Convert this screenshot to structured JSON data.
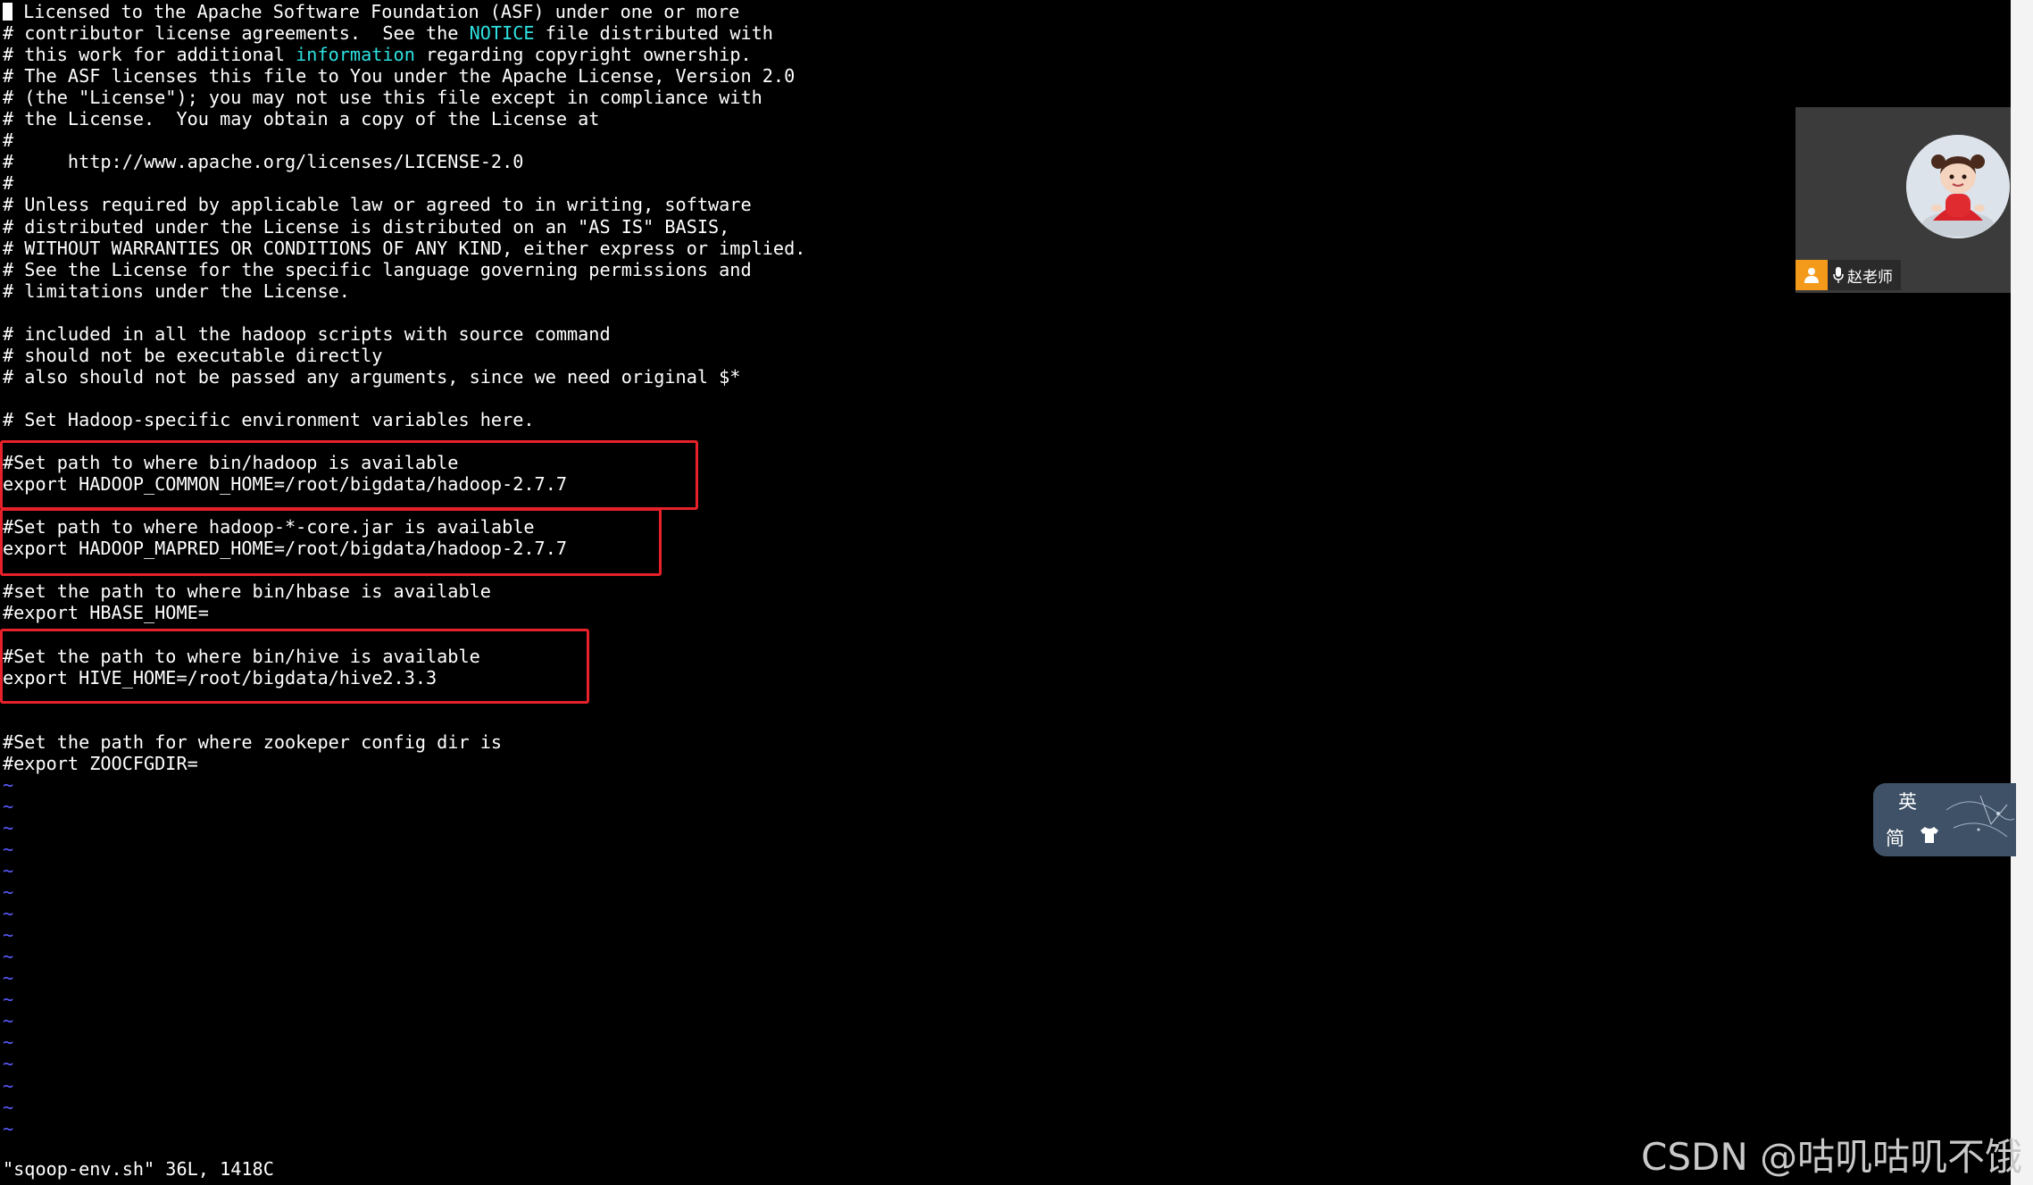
{
  "editor": {
    "lines": [
      {
        "prefix": "",
        "text": " Licensed to the Apache Software Foundation (ASF) under one or more",
        "cursor": true
      },
      {
        "prefix": "",
        "text": "# contributor license agreements.  See the ",
        "kw": "NOTICE",
        "after": " file distributed with"
      },
      {
        "prefix": "",
        "text": "# this work for additional ",
        "kw": "information",
        "after": " regarding copyright ownership."
      },
      {
        "prefix": "",
        "text": "# The ASF licenses this file to You under the Apache License, Version 2.0"
      },
      {
        "prefix": "",
        "text": "# (the \"License\"); you may not use this file except in compliance with"
      },
      {
        "prefix": "",
        "text": "# the License.  You may obtain a copy of the License at"
      },
      {
        "prefix": "",
        "text": "#"
      },
      {
        "prefix": "",
        "text": "#     http://www.apache.org/licenses/LICENSE-2.0"
      },
      {
        "prefix": "",
        "text": "#"
      },
      {
        "prefix": "",
        "text": "# Unless required by applicable law or agreed to in writing, software"
      },
      {
        "prefix": "",
        "text": "# distributed under the License is distributed on an \"AS IS\" BASIS,"
      },
      {
        "prefix": "",
        "text": "# WITHOUT WARRANTIES OR CONDITIONS OF ANY KIND, either express or implied."
      },
      {
        "prefix": "",
        "text": "# See the License for the specific language governing permissions and"
      },
      {
        "prefix": "",
        "text": "# limitations under the License."
      },
      {
        "prefix": "",
        "text": ""
      },
      {
        "prefix": "",
        "text": "# included in all the hadoop scripts with source command"
      },
      {
        "prefix": "",
        "text": "# should not be executable directly"
      },
      {
        "prefix": "",
        "text": "# also should not be passed any arguments, since we need original $*"
      },
      {
        "prefix": "",
        "text": ""
      },
      {
        "prefix": "",
        "text": "# Set Hadoop-specific environment variables here."
      },
      {
        "prefix": "",
        "text": ""
      },
      {
        "prefix": "",
        "text": "#Set path to where bin/hadoop is available"
      },
      {
        "prefix": "",
        "text": "export HADOOP_COMMON_HOME=/root/bigdata/hadoop-2.7.7"
      },
      {
        "prefix": "",
        "text": ""
      },
      {
        "prefix": "",
        "text": "#Set path to where hadoop-*-core.jar is available"
      },
      {
        "prefix": "",
        "text": "export HADOOP_MAPRED_HOME=/root/bigdata/hadoop-2.7.7"
      },
      {
        "prefix": "",
        "text": ""
      },
      {
        "prefix": "",
        "text": "#set the path to where bin/hbase is available"
      },
      {
        "prefix": "",
        "text": "#export HBASE_HOME="
      },
      {
        "prefix": "",
        "text": ""
      },
      {
        "prefix": "",
        "text": "#Set the path to where bin/hive is available"
      },
      {
        "prefix": "",
        "text": "export HIVE_HOME=/root/bigdata/hive2.3.3"
      },
      {
        "prefix": "",
        "text": ""
      },
      {
        "prefix": "",
        "text": ""
      },
      {
        "prefix": "",
        "text": "#Set the path for where zookeper config dir is"
      },
      {
        "prefix": "",
        "text": "#export ZOOCFGDIR="
      }
    ],
    "tilde": "~",
    "tilde_count": 17,
    "status_line": "\"sqoop-env.sh\" 36L, 1418C"
  },
  "video": {
    "presenter_name": "赵老师"
  },
  "ime": {
    "lang_label": "英",
    "mode_label": "简"
  },
  "watermark": "CSDN @咕叽咕叽不饿"
}
